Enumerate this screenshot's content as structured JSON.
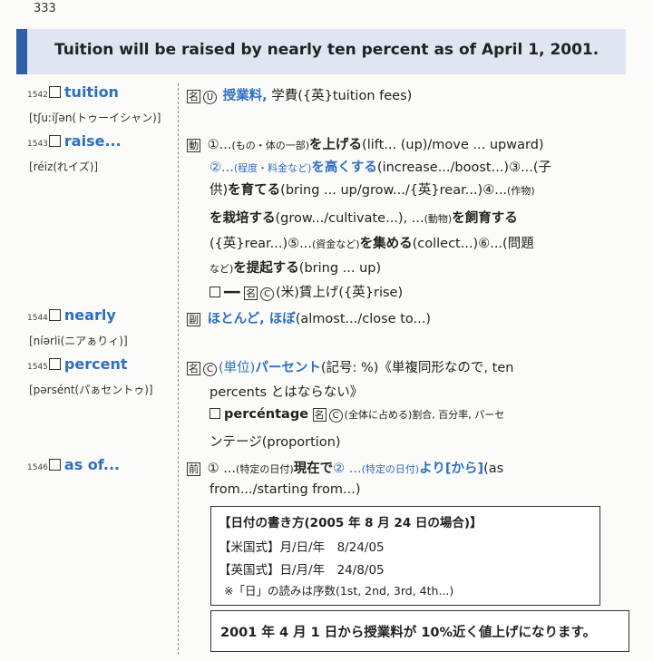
{
  "page_number": "333",
  "banner": "Tuition will be raised by nearly ten percent as of April 1, 2001.",
  "entries": {
    "tuition": {
      "num": "1542",
      "word": "tuition",
      "pron": "[tʃuːíʃən(トゥーイシャン)]"
    },
    "raise": {
      "num": "1543",
      "word": "raise...",
      "pron": "[réiz(れイズ)]"
    },
    "nearly": {
      "num": "1544",
      "word": "nearly",
      "pron": "[níərli(ニアぁりィ)]"
    },
    "percent": {
      "num": "1545",
      "word": "percent",
      "pron": "[pərsént(パぁセントゥ)]"
    },
    "asof": {
      "num": "1546",
      "word": "as of...",
      "pron": ""
    }
  },
  "defs": {
    "tuition_pos": "名",
    "tuition_u": "U",
    "tuition_main": "授業料,",
    "tuition_rest": "学費({英}tuition fees)",
    "raise_pos": "動",
    "raise_l1a": "①...",
    "raise_l1b": "(もの・体の一部)",
    "raise_l1c": "を上げる",
    "raise_l1d": "(lift... (up)/move ... upward)",
    "raise_l2a": "②...",
    "raise_l2b": "(程度・料金など)",
    "raise_l2c": "を高くする",
    "raise_l2d": "(increase.../boost...)③...(子",
    "raise_l3a": "供)",
    "raise_l3b": "を育てる",
    "raise_l3c": "(bring ... up/grow.../{英}rear...)④...",
    "raise_l3d": "(作物)",
    "raise_l4a": "を栽培する",
    "raise_l4b": "(grow.../cultivate...), ...",
    "raise_l4c": "(動物)",
    "raise_l4d": "を飼育する",
    "raise_l5a": "({英}rear...)⑤...",
    "raise_l5b": "(資金など)",
    "raise_l5c": "を集める",
    "raise_l5d": "(collect...)⑥...(問題",
    "raise_l6a": "など)",
    "raise_l6b": "を提起する",
    "raise_l6c": "(bring ... up)",
    "raise_l7a": "━━",
    "raise_l7b": "名",
    "raise_l7c": "C",
    "raise_l7d": "(米)賃上げ({英}rise)",
    "nearly_pos": "副",
    "nearly_main": "ほとんど, ほぼ",
    "nearly_rest": "(almost.../close to...)",
    "percent_pos": "名",
    "percent_c": "C",
    "percent_l1a": "(単位)",
    "percent_l1b": "パーセント",
    "percent_l1c": "(記号: %)《単複同形なので, ten",
    "percent_l2": "percents とはならない》",
    "percent_l3a": "percéntage",
    "percent_l3b": "名",
    "percent_l3c": "C",
    "percent_l3d": "(全体に占める)割合, 百分率, パーセ",
    "percent_l4": "ンテージ(proportion)",
    "asof_pos": "前",
    "asof_l1a": "① ...",
    "asof_l1b": "(特定の日付)",
    "asof_l1c": "現在で",
    "asof_l1d": "② ...",
    "asof_l1e": "(特定の日付)",
    "asof_l1f": "より[から]",
    "asof_l1g": "(as",
    "asof_l2": "from.../starting from...)"
  },
  "box1": {
    "title": "【日付の書き方(2005 年 8 月 24 日の場合)】",
    "us": "【米国式】月/日/年　8/24/05",
    "uk": "【英国式】日/月/年　24/8/05",
    "note": "※「日」の読みは序数(1st, 2nd, 3rd, 4th...)"
  },
  "box2": "2001 年 4 月 1 日から授業料が 10%近く値上げになります。"
}
